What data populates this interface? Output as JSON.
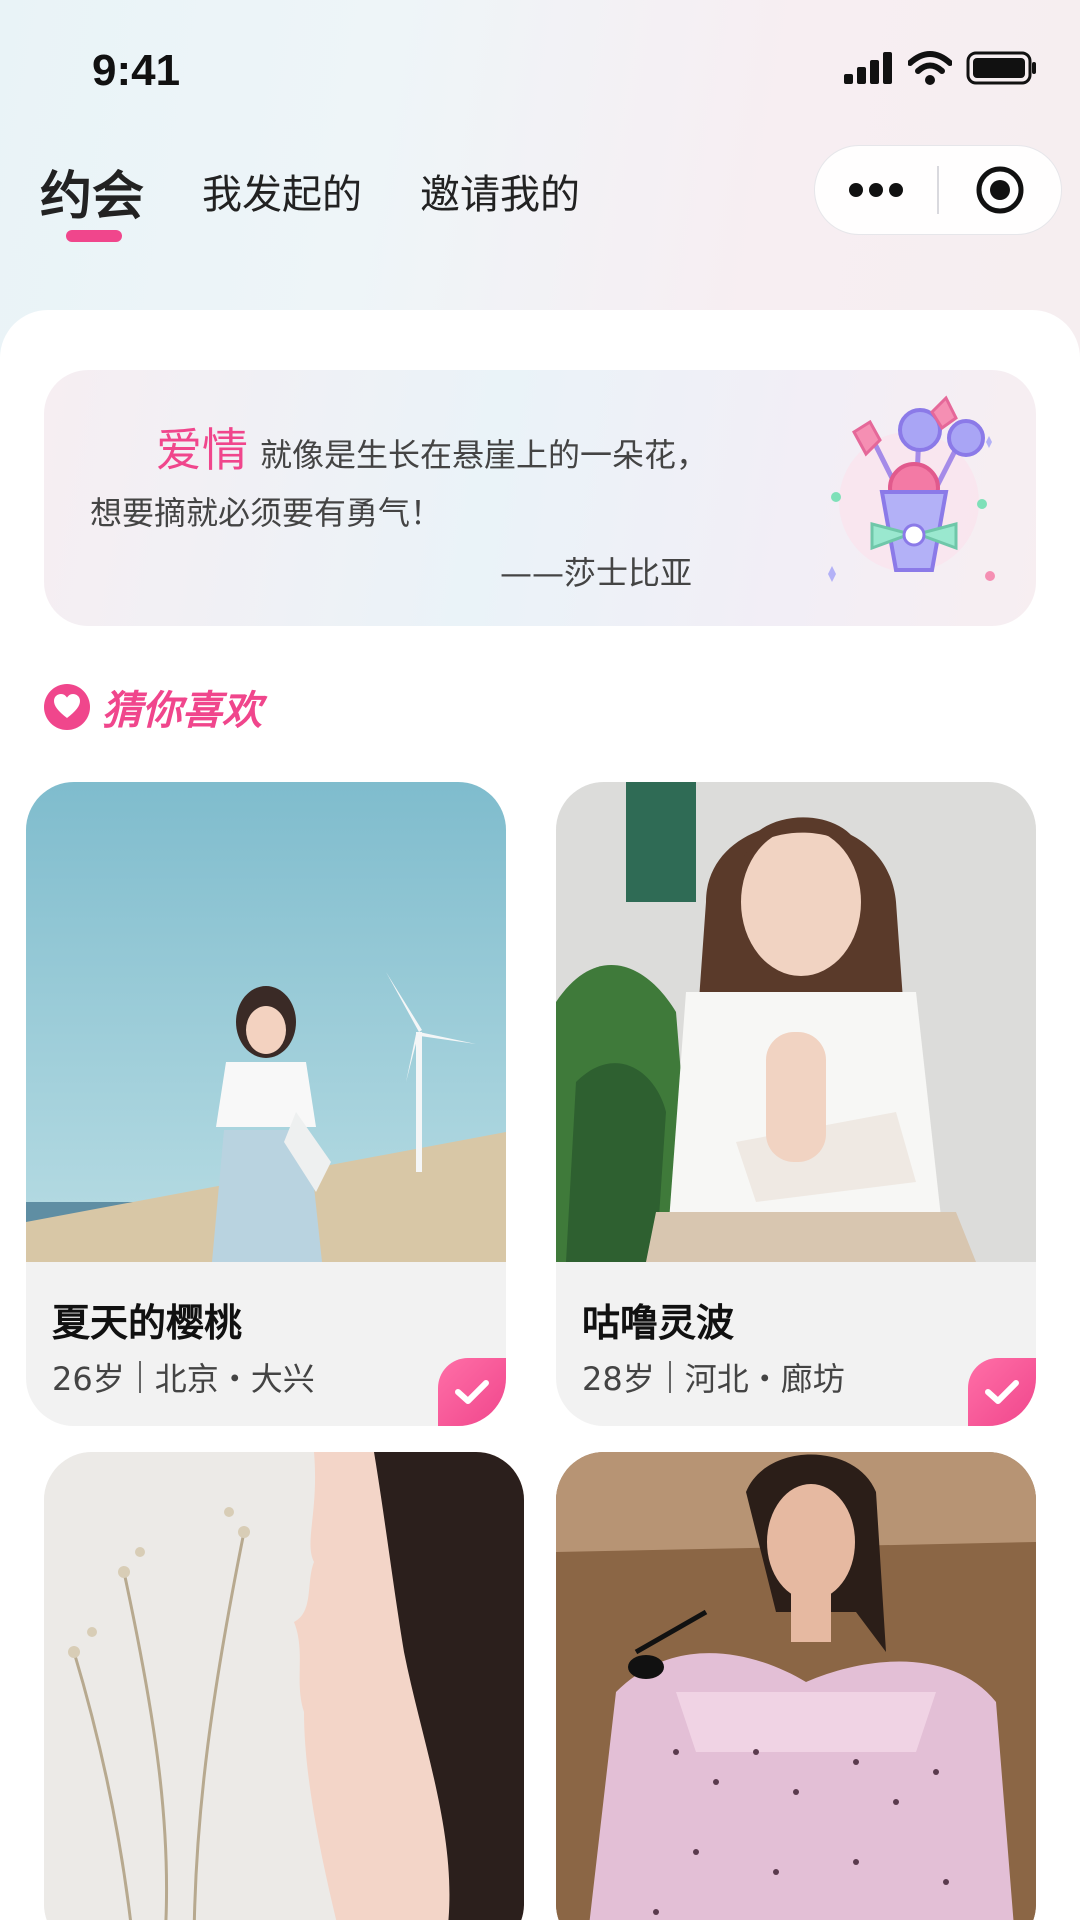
{
  "status": {
    "time": "9:41",
    "icons": [
      "signal-icon",
      "wifi-icon",
      "battery-icon"
    ]
  },
  "nav": {
    "tabs": [
      {
        "label": "约会",
        "active": true
      },
      {
        "label": "我发起的",
        "active": false
      },
      {
        "label": "邀请我的",
        "active": false
      }
    ],
    "capsule_icons": [
      "more-icon",
      "target-icon"
    ]
  },
  "quote": {
    "keyword": "爱情",
    "line1_rest": "就像是生长在悬崖上的一朵花，",
    "line2": "想要摘就必须要有勇气！",
    "author": "——莎士比亚"
  },
  "section": {
    "title": "猜你喜欢",
    "icon": "heart-icon"
  },
  "cards": [
    {
      "name": "夏天的樱桃",
      "age": "26岁",
      "location": "北京・大兴",
      "checked": true
    },
    {
      "name": "咕噜灵波",
      "age": "28岁",
      "location": "河北・廊坊",
      "checked": true
    },
    {
      "name": "",
      "age": "",
      "location": "",
      "checked": false
    },
    {
      "name": "",
      "age": "",
      "location": "",
      "checked": false
    }
  ],
  "colors": {
    "accent": "#f0468c",
    "text": "#111111",
    "muted": "#444444",
    "card_bg": "#f2f2f2"
  }
}
